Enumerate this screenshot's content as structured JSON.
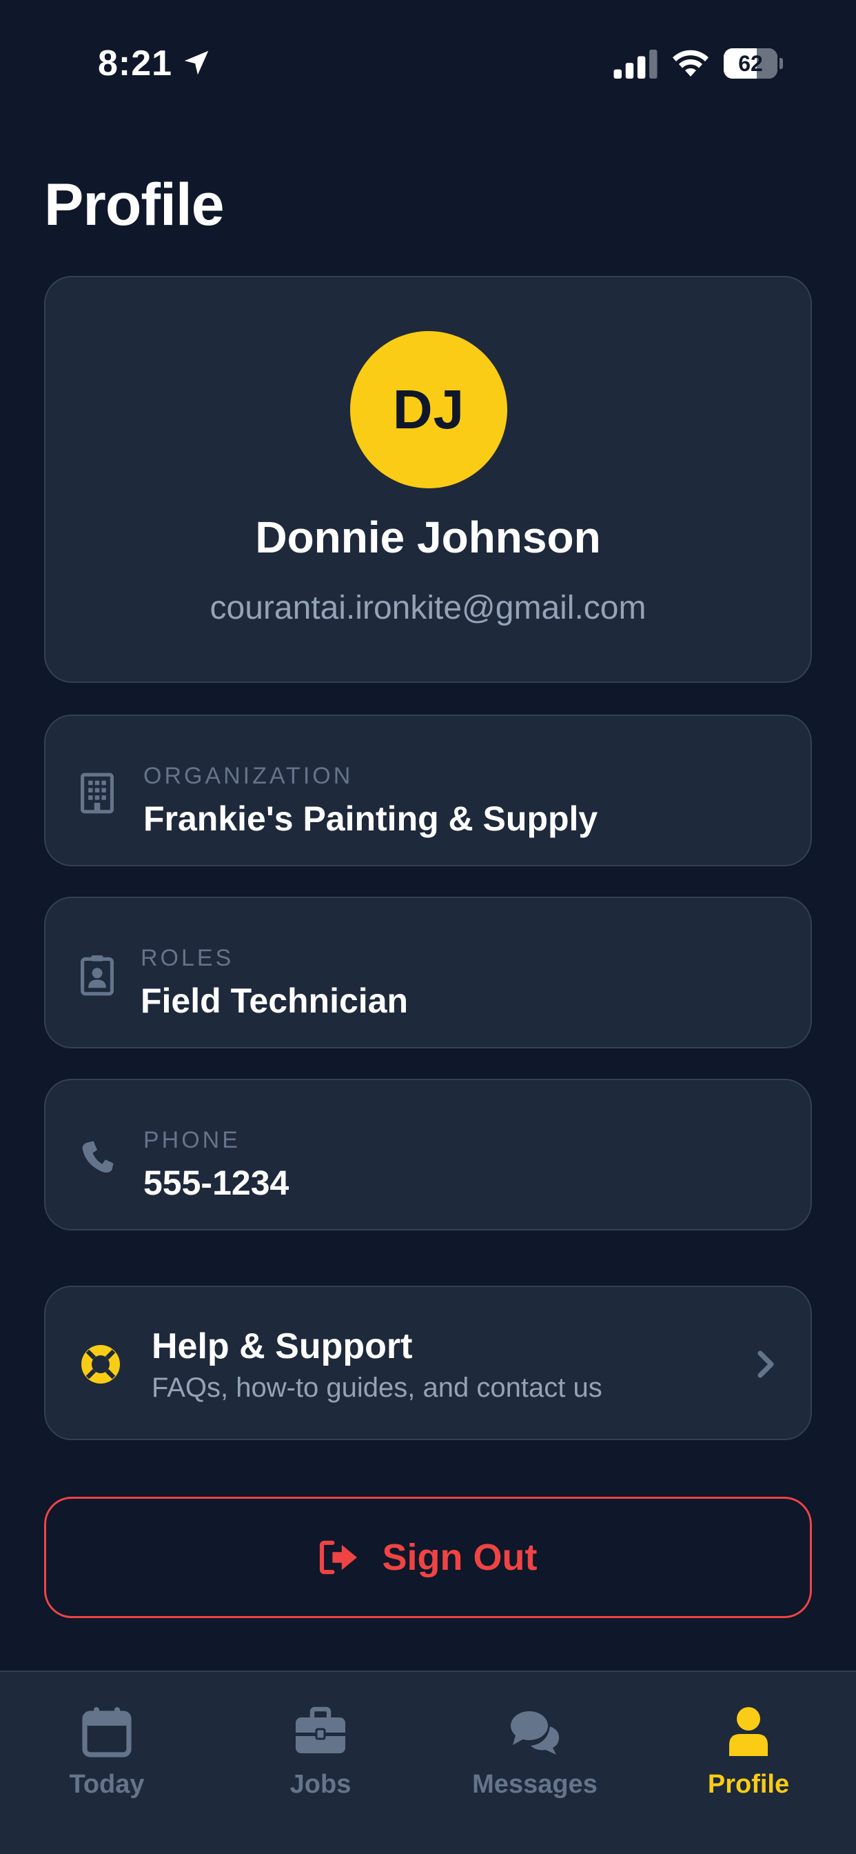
{
  "status_bar": {
    "time": "8:21",
    "battery_level": 62,
    "battery_text": "62"
  },
  "page": {
    "title": "Profile"
  },
  "profile": {
    "initials": "DJ",
    "name": "Donnie Johnson",
    "email": "courantai.ironkite@gmail.com",
    "avatar_color": "#facc15"
  },
  "info": {
    "organization": {
      "label": "ORGANIZATION",
      "value": "Frankie's Painting & Supply",
      "icon": "building-icon"
    },
    "roles": {
      "label": "ROLES",
      "value": "Field Technician",
      "icon": "id-badge-icon"
    },
    "phone": {
      "label": "PHONE",
      "value": "555-1234",
      "icon": "phone-icon"
    }
  },
  "help": {
    "title": "Help & Support",
    "subtitle": "FAQs, how-to guides, and contact us",
    "icon": "life-ring-icon"
  },
  "sign_out": {
    "label": "Sign Out",
    "icon": "sign-out-icon",
    "color": "#ef4444"
  },
  "tabs": [
    {
      "label": "Today",
      "icon": "calendar-icon",
      "active": false
    },
    {
      "label": "Jobs",
      "icon": "briefcase-icon",
      "active": false
    },
    {
      "label": "Messages",
      "icon": "chat-bubbles-icon",
      "active": false
    },
    {
      "label": "Profile",
      "icon": "user-icon",
      "active": true
    }
  ],
  "colors": {
    "background": "#0f172a",
    "card": "#1e293b",
    "accent": "#facc15",
    "muted": "#94a3b8",
    "danger": "#ef4444"
  }
}
